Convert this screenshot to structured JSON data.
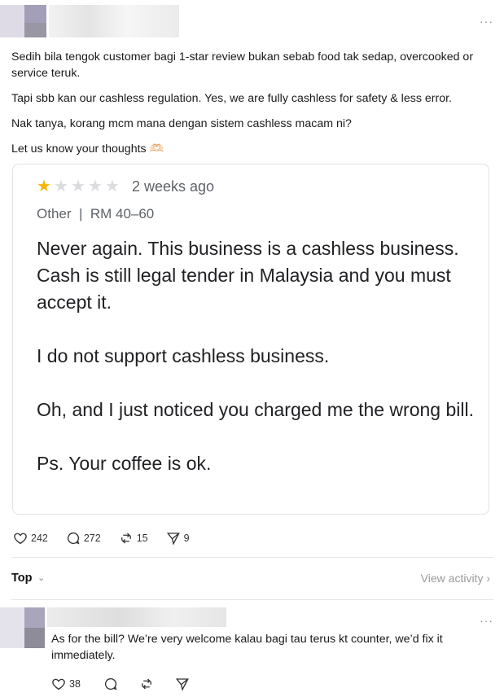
{
  "post": {
    "more_label": "···",
    "paragraphs": [
      "Sedih bila tengok customer bagi 1-star review bukan sebab food tak sedap, overcooked or service teruk.",
      "Tapi sbb kan our cashless regulation. Yes, we are fully cashless for safety & less error.",
      "Nak tanya, korang mcm mana dengan sistem cashless macam ni?",
      "Let us know your thoughts 🫶🏻"
    ]
  },
  "review": {
    "rating": 1,
    "max_rating": 5,
    "date": "2 weeks ago",
    "meta": "Other  |  RM 40–60",
    "body": [
      "Never again. This business is a cashless business. Cash is still legal tender in Malaysia and you must accept it.",
      "I do not support cashless business.",
      "Oh, and I just noticed you charged me the wrong bill.",
      "Ps. Your coffee is ok."
    ]
  },
  "post_actions": {
    "likes": "242",
    "replies": "272",
    "reposts": "15",
    "shares": "9"
  },
  "sort": {
    "label": "Top",
    "chevron": "⌄",
    "view_activity": "View activity ›"
  },
  "reply": {
    "more_label": "···",
    "text": "As for the bill? We’re very welcome kalau bagi tau terus kt counter, we’d fix it immediately.",
    "likes": "38"
  },
  "icons": {
    "like": "heart-outline",
    "reply": "speech-bubble-outline",
    "repost": "repost-arrows",
    "share": "paper-plane-outline"
  }
}
